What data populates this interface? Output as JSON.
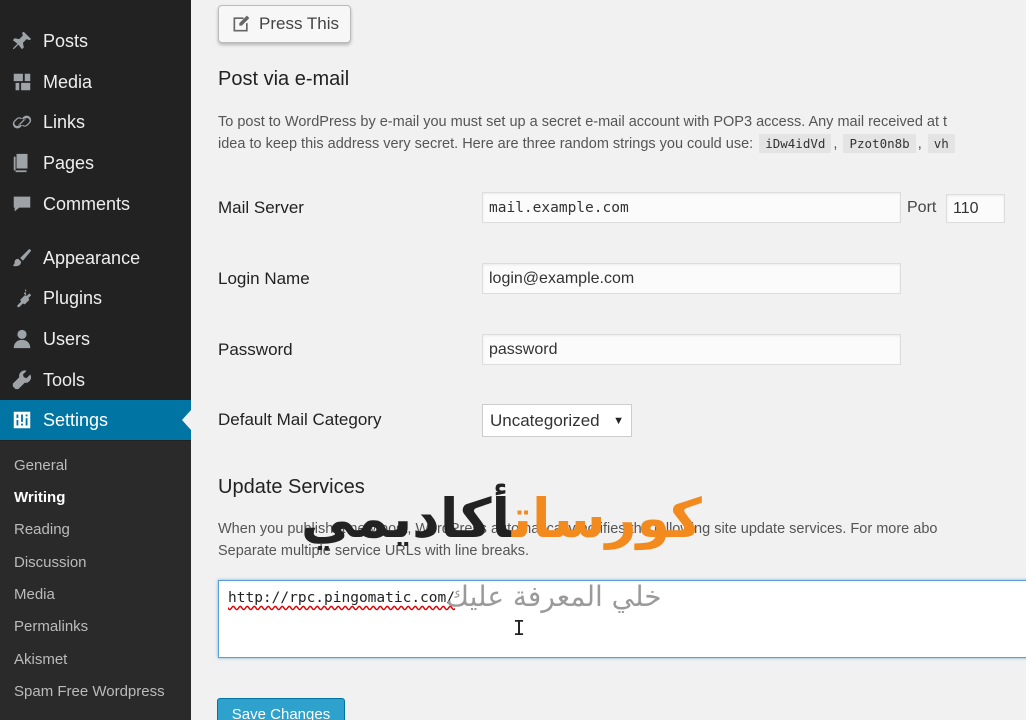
{
  "sidebar": {
    "items": [
      {
        "label": "Posts",
        "icon": "pushpin-icon"
      },
      {
        "label": "Media",
        "icon": "media-icon"
      },
      {
        "label": "Links",
        "icon": "link-icon"
      },
      {
        "label": "Pages",
        "icon": "pages-icon"
      },
      {
        "label": "Comments",
        "icon": "comment-icon"
      },
      {
        "label": "Appearance",
        "icon": "paintbrush-icon"
      },
      {
        "label": "Plugins",
        "icon": "plugin-icon"
      },
      {
        "label": "Users",
        "icon": "user-icon"
      },
      {
        "label": "Tools",
        "icon": "wrench-icon"
      },
      {
        "label": "Settings",
        "icon": "settings-icon"
      }
    ],
    "submenu": [
      "General",
      "Writing",
      "Reading",
      "Discussion",
      "Media",
      "Permalinks",
      "Akismet",
      "Spam Free Wordpress"
    ],
    "active_color": "#0074a2"
  },
  "press_this": {
    "label": "Press This"
  },
  "post_via_email": {
    "heading": "Post via e-mail",
    "desc_line1": "To post to WordPress by e-mail you must set up a secret e-mail account with POP3 access. Any mail received at t",
    "desc_line2": "idea to keep this address very secret. Here are three random strings you could use:",
    "random1": "iDw4idVd",
    "random2": "Pzot0n8b",
    "random3": "vh",
    "sep": ","
  },
  "form": {
    "mail_server_label": "Mail Server",
    "mail_server_value": "mail.example.com",
    "port_label": "Port",
    "port_value": "110",
    "login_label": "Login Name",
    "login_value": "login@example.com",
    "password_label": "Password",
    "password_value": "password",
    "category_label": "Default Mail Category",
    "category_value": "Uncategorized"
  },
  "update_services": {
    "heading": "Update Services",
    "desc_line1": "When you publish a new post, WordPress automatically notifies the following site update services. For more abo",
    "desc_line2": "Separate multiple service URLs with line breaks.",
    "ping_url": "http://rpc.pingomatic.com/"
  },
  "save": {
    "label": "Save Changes"
  },
  "watermark": {
    "word_orange": "كورسات",
    "word_black": "أكاديمي",
    "tagline": "خلي المعرفة عليك",
    "colors": {
      "orange": "#f28a1e",
      "black": "#222222"
    }
  }
}
